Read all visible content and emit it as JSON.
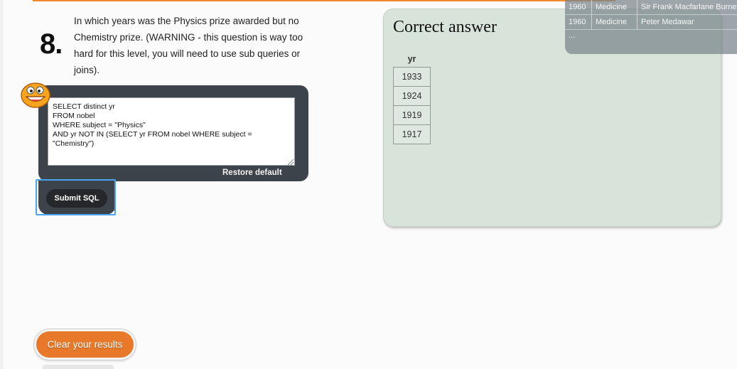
{
  "question": {
    "number": "8.",
    "text": "In which years was the Physics prize awarded but no Chemistry prize. (WARNING - this question is way too hard for this level, you will need to use sub queries or joins)."
  },
  "editor": {
    "sql": "SELECT distinct yr\nFROM nobel\nWHERE subject = \"Physics\"\nAND yr NOT IN (SELECT yr FROM nobel WHERE subject =\n\"Chemistry\")",
    "restore_label": "Restore default",
    "submit_label": "Submit SQL"
  },
  "answer": {
    "title": "Correct answer",
    "column": "yr",
    "rows": [
      "1933",
      "1924",
      "1919",
      "1917"
    ]
  },
  "overlay": {
    "rows": [
      [
        "1960",
        "Medicine",
        "Sir Frank Macfarlane Burnet"
      ],
      [
        "1960",
        "Medicine",
        "Peter Medawar"
      ]
    ],
    "ellipsis": "..."
  },
  "footer": {
    "clear_label": "Clear your results"
  },
  "colors": {
    "accent": "#f08a2c",
    "clear_button": "#e8792a",
    "editor_bg": "#3d434b",
    "answer_bg": "#d8e4da",
    "focus": "#4aa3f0"
  }
}
